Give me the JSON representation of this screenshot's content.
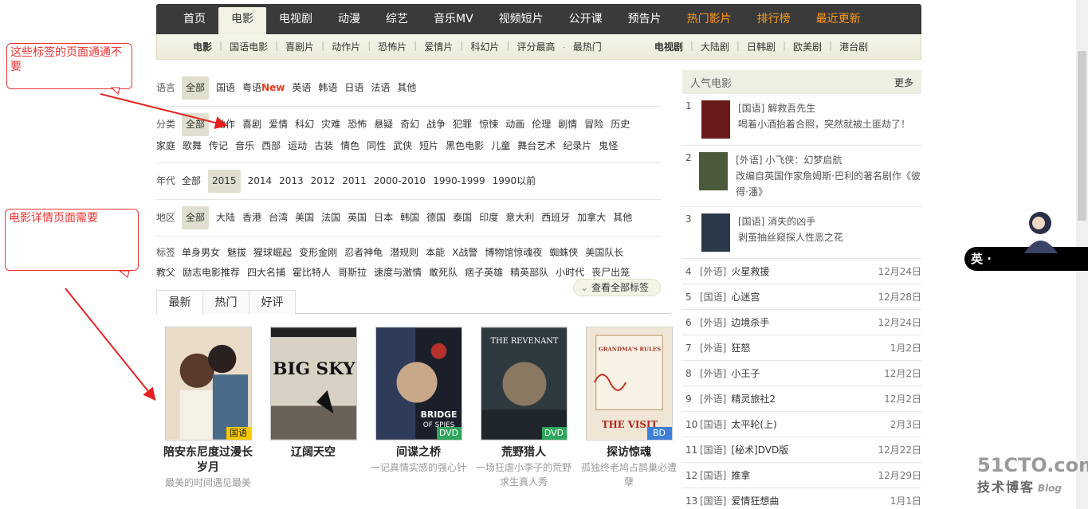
{
  "topnav": [
    {
      "label": "首页",
      "style": "normal"
    },
    {
      "label": "电影",
      "style": "active"
    },
    {
      "label": "电视剧",
      "style": "normal"
    },
    {
      "label": "动漫",
      "style": "normal"
    },
    {
      "label": "综艺",
      "style": "normal"
    },
    {
      "label": "音乐MV",
      "style": "normal"
    },
    {
      "label": "视频短片",
      "style": "normal"
    },
    {
      "label": "公开课",
      "style": "normal"
    },
    {
      "label": "预告片",
      "style": "normal"
    },
    {
      "label": "热门影片",
      "style": "orange"
    },
    {
      "label": "排行榜",
      "style": "orange"
    },
    {
      "label": "最近更新",
      "style": "orange"
    }
  ],
  "subnav": {
    "movie_head": "电影",
    "movie_items": [
      "国语电影",
      "喜剧片",
      "动作片",
      "恐怖片",
      "爱情片",
      "科幻片"
    ],
    "extra": "评分最高",
    "dash": "-",
    "hot": "最热门",
    "tv_head": "电视剧",
    "tv_items": [
      "大陆剧",
      "日韩剧",
      "欧美剧",
      "港台剧"
    ]
  },
  "filters": {
    "lang": {
      "label": "语言",
      "selected": "全部",
      "items": [
        "国语",
        "粤语"
      ],
      "new": "New",
      "items2": [
        "英语",
        "韩语",
        "日语",
        "法语",
        "其他"
      ]
    },
    "genre": {
      "label": "分类",
      "selected": "全部",
      "row1": [
        "动作",
        "喜剧",
        "爱情",
        "科幻",
        "灾难",
        "恐怖",
        "悬疑",
        "奇幻",
        "战争",
        "犯罪",
        "惊悚",
        "动画",
        "伦理",
        "剧情",
        "冒险",
        "历史"
      ],
      "row2": [
        "家庭",
        "歌舞",
        "传记",
        "音乐",
        "西部",
        "运动",
        "古装",
        "情色",
        "同性",
        "武侠",
        "短片",
        "黑色电影",
        "儿童",
        "舞台艺术",
        "纪录片",
        "鬼怪"
      ]
    },
    "year": {
      "label": "年代",
      "items_before": [
        "全部"
      ],
      "selected": "2015",
      "items": [
        "2014",
        "2013",
        "2012",
        "2011",
        "2000-2010",
        "1990-1999",
        "1990以前"
      ]
    },
    "region": {
      "label": "地区",
      "selected": "全部",
      "items": [
        "大陆",
        "香港",
        "台湾",
        "美国",
        "法国",
        "英国",
        "日本",
        "韩国",
        "德国",
        "泰国",
        "印度",
        "意大利",
        "西班牙",
        "加拿大",
        "其他"
      ]
    },
    "tags": {
      "label": "标签",
      "row1": [
        "单身男女",
        "魅拔",
        "猩球崛起",
        "变形金刚",
        "忍者神龟",
        "潜规则",
        "本能",
        "X战警",
        "博物馆惊魂夜",
        "蜘蛛侠",
        "美国队长"
      ],
      "row2": [
        "教父",
        "励志电影推荐",
        "四大名捕",
        "霍比特人",
        "哥斯拉",
        "速度与激情",
        "敢死队",
        "痞子英雄",
        "精英部队",
        "小时代",
        "丧尸出笼"
      ]
    },
    "see_all": "查看全部标签"
  },
  "tabs": [
    "最新",
    "热门",
    "好评"
  ],
  "movies": [
    {
      "title": "陪安东尼度过漫长岁月",
      "desc": "最美的时间遇见最美",
      "badge": "国语",
      "badge_color": "#f5c800",
      "art": "couple"
    },
    {
      "title": "辽阔天空",
      "desc": "",
      "badge": "",
      "badge_color": "",
      "art": "bigsky"
    },
    {
      "title": "间谍之桥",
      "desc": "一记真情实感的强心针",
      "badge": "DVD",
      "badge_color": "#2ea55b",
      "art": "bridge"
    },
    {
      "title": "荒野猎人",
      "desc": "一场狂虐小李子的荒野求生真人秀",
      "badge": "DVD",
      "badge_color": "#2ea55b",
      "art": "revenant"
    },
    {
      "title": "探访惊魂",
      "desc": "孤独终老鸠占鹊巢必遭孽",
      "badge": "BD",
      "badge_color": "#3d7fd6",
      "art": "visit"
    }
  ],
  "right": {
    "title": "人气电影",
    "more": "更多",
    "top3": [
      {
        "rank": "1",
        "lang": "[国语]",
        "name": "解救吾先生",
        "desc": "喝着小酒抬着合照，突然就被土匪劫了！"
      },
      {
        "rank": "2",
        "lang": "[外语]",
        "name": "小飞侠：幻梦启航",
        "desc": "改编自英国作家詹姆斯·巴利的著名剧作《彼得·潘》"
      },
      {
        "rank": "3",
        "lang": "[国语]",
        "name": "消失的凶手",
        "desc": "剥茧抽丝窥探人性恶之花"
      }
    ],
    "list": [
      {
        "rank": "4",
        "lang": "[外语]",
        "name": "火星救援",
        "date": "12月24日"
      },
      {
        "rank": "5",
        "lang": "[国语]",
        "name": "心迷宫",
        "date": "12月28日"
      },
      {
        "rank": "6",
        "lang": "[外语]",
        "name": "边境杀手",
        "date": "12月24日"
      },
      {
        "rank": "7",
        "lang": "[外语]",
        "name": "狂怒",
        "date": "1月2日"
      },
      {
        "rank": "8",
        "lang": "[外语]",
        "name": "小王子",
        "date": "12月2日"
      },
      {
        "rank": "9",
        "lang": "[外语]",
        "name": "精灵旅社2",
        "date": "12月2日"
      },
      {
        "rank": "10",
        "lang": "[国语]",
        "name": "太平轮(上)",
        "date": "2月3日"
      },
      {
        "rank": "11",
        "lang": "[国语]",
        "name": "[秘术]DVD版",
        "date": "12月22日"
      },
      {
        "rank": "12",
        "lang": "[国语]",
        "name": "推拿",
        "date": "12月29日"
      },
      {
        "rank": "13",
        "lang": "[国语]",
        "name": "爱情狂想曲",
        "date": "1月1日"
      }
    ]
  },
  "annotations": {
    "note1": "这些标签的页面通通不要",
    "note2": "电影详情页面需要",
    "arrow_color": "#e62020"
  },
  "widget": "英 ·",
  "watermark": {
    "site": "51CTO.com",
    "cn": "技术博客",
    "blog": "Blog"
  }
}
